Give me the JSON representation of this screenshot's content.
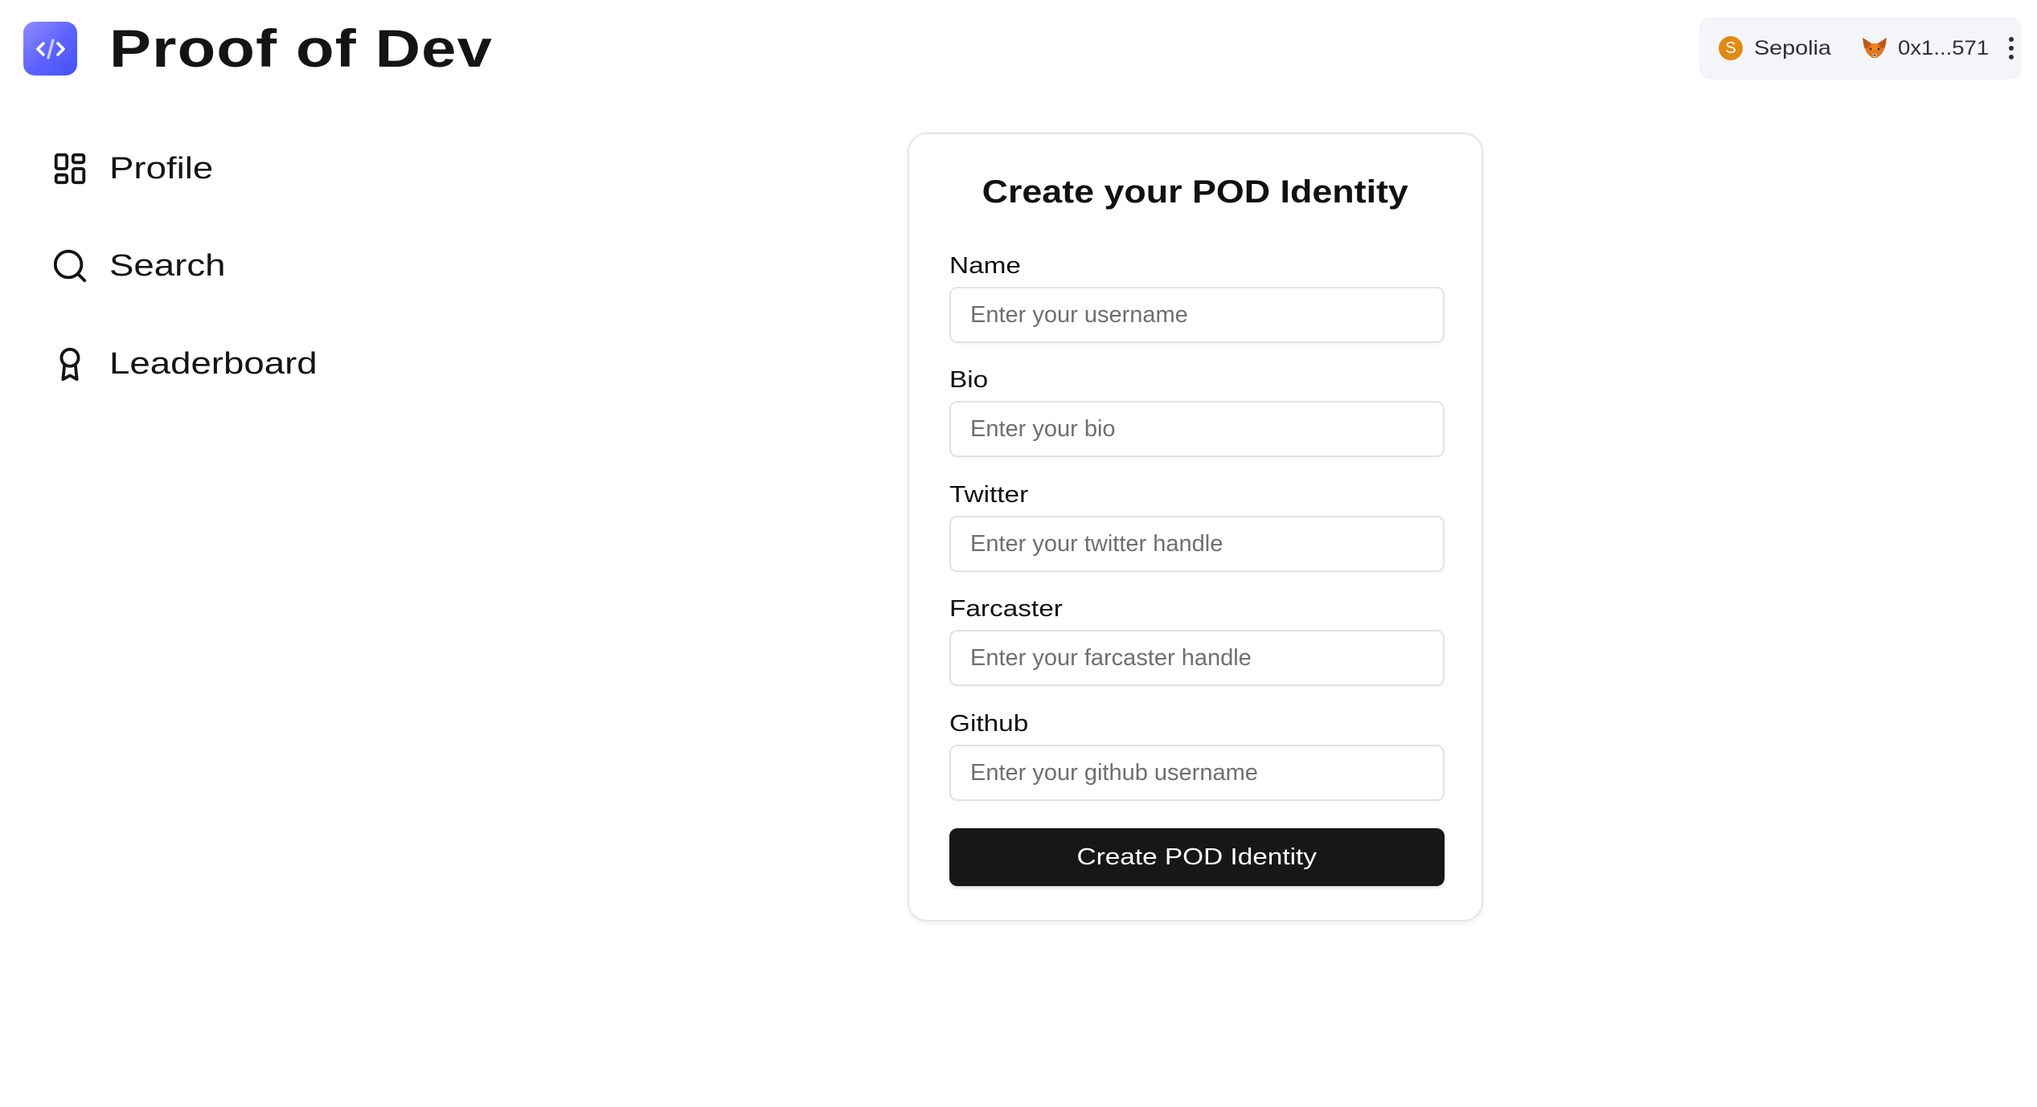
{
  "app": {
    "title": "Proof of Dev",
    "logo_icon": "code-brackets-icon",
    "brand_color": "#5b61ff"
  },
  "sidebar": {
    "items": [
      {
        "label": "Profile",
        "icon": "dashboard-grid-icon"
      },
      {
        "label": "Search",
        "icon": "search-icon"
      },
      {
        "label": "Leaderboard",
        "icon": "award-ribbon-icon"
      }
    ]
  },
  "wallet": {
    "network_badge": "S",
    "network_name": "Sepolia",
    "network_color": "#e08a14",
    "wallet_icon": "metamask-fox-icon",
    "account_address": "0x1...571",
    "menu_icon": "more-vertical-icon"
  },
  "form": {
    "title": "Create your POD Identity",
    "fields": [
      {
        "label": "Name",
        "placeholder": "Enter your username",
        "value": ""
      },
      {
        "label": "Bio",
        "placeholder": "Enter your bio",
        "value": ""
      },
      {
        "label": "Twitter",
        "placeholder": "Enter your twitter handle",
        "value": ""
      },
      {
        "label": "Farcaster",
        "placeholder": "Enter your farcaster handle",
        "value": ""
      },
      {
        "label": "Github",
        "placeholder": "Enter your github username",
        "value": ""
      }
    ],
    "submit_label": "Create POD Identity"
  }
}
